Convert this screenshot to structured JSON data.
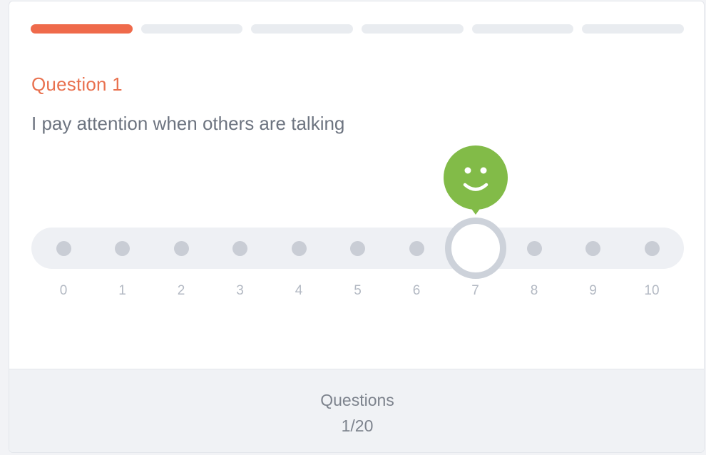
{
  "progress": {
    "segments": 6,
    "active_segments": 1,
    "active_color": "#ef6a4b",
    "inactive_color": "#e9ecf0"
  },
  "question": {
    "label": "Question 1",
    "text": "I pay attention when others are talking"
  },
  "scale": {
    "options": [
      "0",
      "1",
      "2",
      "3",
      "4",
      "5",
      "6",
      "7",
      "8",
      "9",
      "10"
    ],
    "selected": "7",
    "selected_icon": "smiley-face-icon",
    "selected_color": "#82bb48"
  },
  "footer": {
    "label": "Questions",
    "count": "1/20"
  }
}
